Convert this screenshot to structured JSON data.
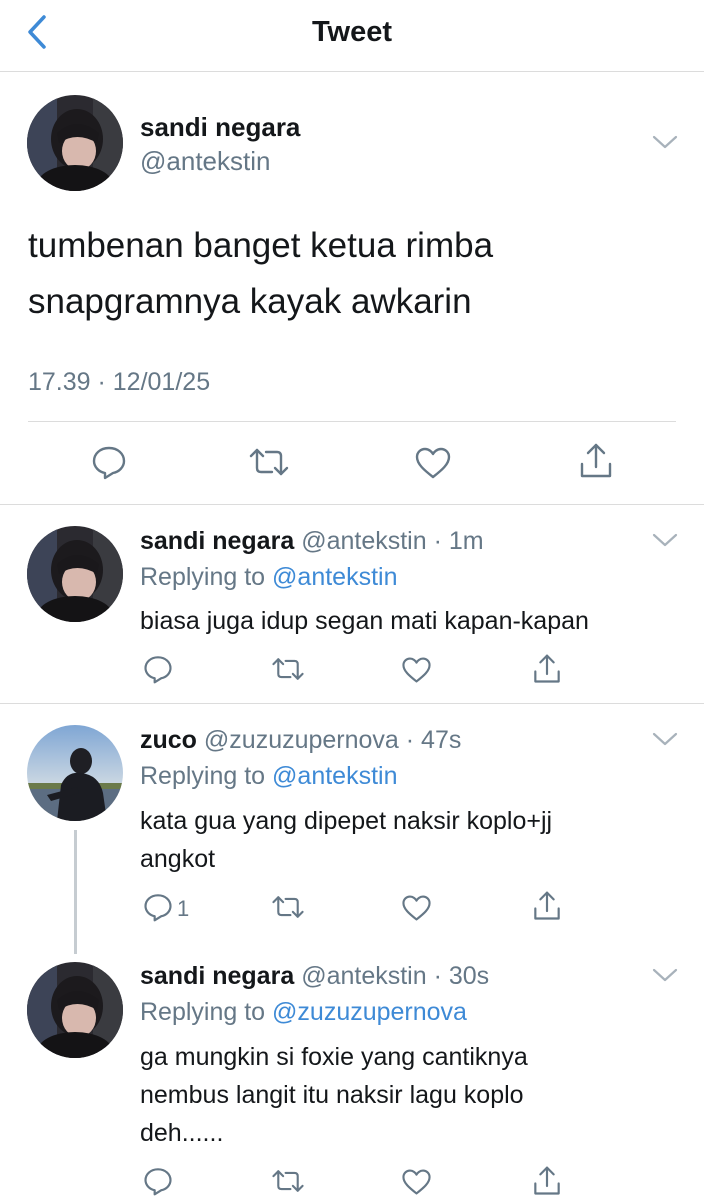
{
  "header": {
    "title": "Tweet"
  },
  "main_tweet": {
    "name": "sandi negara",
    "handle": "@antekstin",
    "text_line1": "tumbenan banget ketua rimba",
    "text_line2": "snapgramnya kayak awkarin",
    "timestamp": "17.39 · 12/01/25"
  },
  "replies": [
    {
      "name": "sandi negara",
      "meta": "@antekstin · 1m",
      "replying_prefix": "Replying to ",
      "replying_to": "@antekstin",
      "lines": [
        "biasa juga idup segan mati kapan-kapan"
      ],
      "reply_count": ""
    },
    {
      "name": "zuco",
      "meta": "@zuzuzupernova · 47s",
      "replying_prefix": "Replying to ",
      "replying_to": "@antekstin",
      "lines": [
        "kata gua yang dipepet naksir koplo+jj",
        "angkot"
      ],
      "reply_count": "1"
    },
    {
      "name": "sandi negara",
      "meta": "@antekstin · 30s",
      "replying_prefix": "Replying to ",
      "replying_to": "@zuzuzupernova",
      "lines": [
        "ga mungkin si foxie yang cantiknya",
        "nembus langit itu naksir lagu koplo",
        "deh......"
      ],
      "reply_count": ""
    }
  ],
  "colors": {
    "link_blue": "#3e8ad6",
    "grey_text": "#657786",
    "icon_grey": "#657786",
    "divider": "#dcdcdc"
  }
}
